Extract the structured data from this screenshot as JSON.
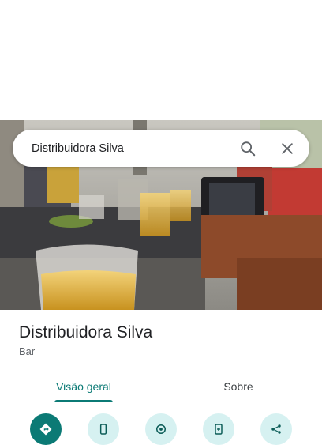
{
  "search": {
    "query": "Distribuidora Silva"
  },
  "place": {
    "name": "Distribuidora Silva",
    "category": "Bar"
  },
  "tabs": [
    {
      "label": "Visão geral",
      "selected": true
    },
    {
      "label": "Sobre",
      "selected": false
    }
  ],
  "actions": [
    {
      "icon": "directions-icon"
    },
    {
      "icon": "phone-icon"
    },
    {
      "icon": "location-arrow-icon"
    },
    {
      "icon": "save-phone-icon"
    },
    {
      "icon": "share-icon"
    }
  ],
  "colors": {
    "accent": "#0b7a75",
    "accent_light": "#d6f1f1",
    "text": "#202124",
    "secondary_text": "#5f6368"
  }
}
